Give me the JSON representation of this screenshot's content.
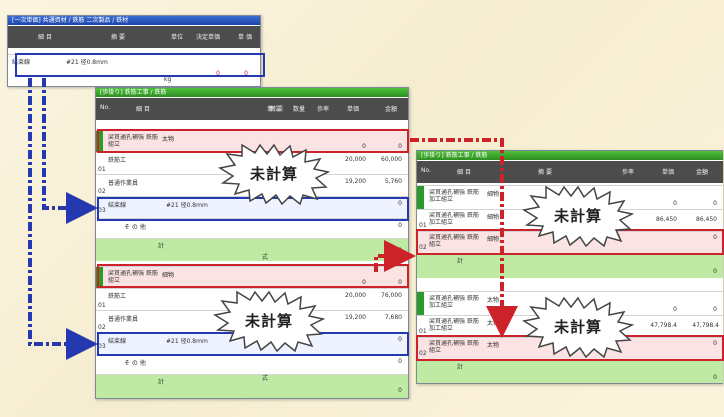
{
  "win1": {
    "title": "[一次単価] 共通資材 / 鉄筋 二次製品 / 鉄材",
    "headers": {
      "item": "細 目",
      "spec": "摘 要",
      "unit": "単位",
      "qty": "決定単価",
      "price": "単 価"
    },
    "row": {
      "item": "結束線",
      "spec": "#21 径0.8mm",
      "unit": "kg",
      "qty": "0",
      "price": "0"
    }
  },
  "win2": {
    "title": "[歩掛り] 鉄筋工事 / 鉄筋",
    "headers": {
      "no": "No.",
      "item": "細 目",
      "spec": "摘 要",
      "unit": "単位",
      "qty": "数量",
      "rate": "歩率",
      "price": "単価",
      "amount": "金額"
    },
    "groupA": {
      "head": {
        "item": "梁貫通孔補強 鉄筋組立",
        "spec": "太物",
        "price": "0",
        "amount": "0"
      },
      "rows": [
        {
          "no": "01",
          "item": "鉄筋工",
          "price": "20,000",
          "amount": "60,000"
        },
        {
          "no": "02",
          "item": "普通作業員",
          "price": "19,200",
          "amount": "5,760"
        },
        {
          "no": "03",
          "item": "結束線",
          "spec": "#21 径0.8mm",
          "amount": "0"
        },
        {
          "item": "そ の 他",
          "amount": "0"
        }
      ],
      "total": {
        "label": "計",
        "unit": "式",
        "amount": "0"
      }
    },
    "groupB": {
      "head": {
        "item": "梁貫通孔補強 鉄筋組立",
        "spec": "細物",
        "price": "0",
        "amount": "0"
      },
      "rows": [
        {
          "no": "01",
          "item": "鉄筋工",
          "price": "20,000",
          "amount": "76,000"
        },
        {
          "no": "02",
          "item": "普通作業員",
          "price": "19,200",
          "amount": "7,680"
        },
        {
          "no": "03",
          "item": "結束線",
          "spec": "#21 径0.8mm",
          "amount": "0"
        },
        {
          "item": "そ の 他",
          "amount": "0"
        }
      ],
      "total": {
        "label": "計",
        "unit": "式",
        "amount": "0"
      }
    }
  },
  "win3": {
    "title": "[歩掛り] 鉄筋工事 / 鉄筋",
    "headers": {
      "no": "No.",
      "item": "細 目",
      "spec": "摘 要",
      "rate": "歩率",
      "price": "単価",
      "amount": "金額"
    },
    "groupA": {
      "head": {
        "item": "梁貫通孔補強 鉄筋加工組立",
        "spec": "細物",
        "price": "0",
        "amount": "0"
      },
      "rows": [
        {
          "no": "01",
          "item": "梁貫通孔補強 鉄筋加工組立",
          "spec": "細物",
          "price": "86,450",
          "amount": "86,450"
        },
        {
          "no": "02",
          "item": "梁貫通孔補強 鉄筋組立",
          "spec": "細物",
          "rate": "1",
          "amount": "0"
        }
      ],
      "total": {
        "label": "計",
        "amount": "0"
      }
    },
    "groupB": {
      "head": {
        "item": "梁貫通孔補強 鉄筋加工組立",
        "spec": "太物",
        "price": "0",
        "amount": "0"
      },
      "rows": [
        {
          "no": "01",
          "item": "梁貫通孔補強 鉄筋加工組立",
          "spec": "太物",
          "price": "47,798.4",
          "amount": "47,798.4"
        },
        {
          "no": "02",
          "item": "梁貫通孔補強 鉄筋組立",
          "spec": "太物",
          "amount": "0"
        }
      ],
      "total": {
        "label": "計",
        "amount": "0"
      }
    }
  },
  "callouts": {
    "uncalculated": "未計算"
  },
  "colors": {
    "red": "#cc2229",
    "blue": "#2438b0",
    "titlebar_green": "#2c8f1f",
    "titlebar_blue": "#1d43a8"
  }
}
